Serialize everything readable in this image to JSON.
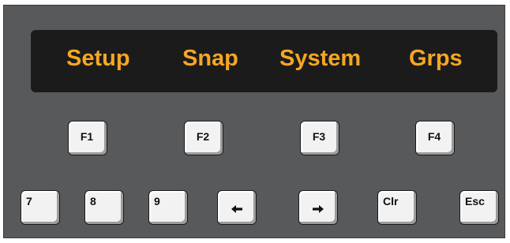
{
  "display": {
    "text_color": "#f5a623",
    "softkeys": [
      "Setup",
      "Snap",
      "System",
      "Grps"
    ]
  },
  "function_keys": [
    "F1",
    "F2",
    "F3",
    "F4"
  ],
  "bottom_keys": {
    "k7": "7",
    "k8": "8",
    "k9": "9",
    "left_arrow_icon": "arrow-left-icon",
    "right_arrow_icon": "arrow-right-icon",
    "clr": "Clr",
    "esc": "Esc"
  }
}
